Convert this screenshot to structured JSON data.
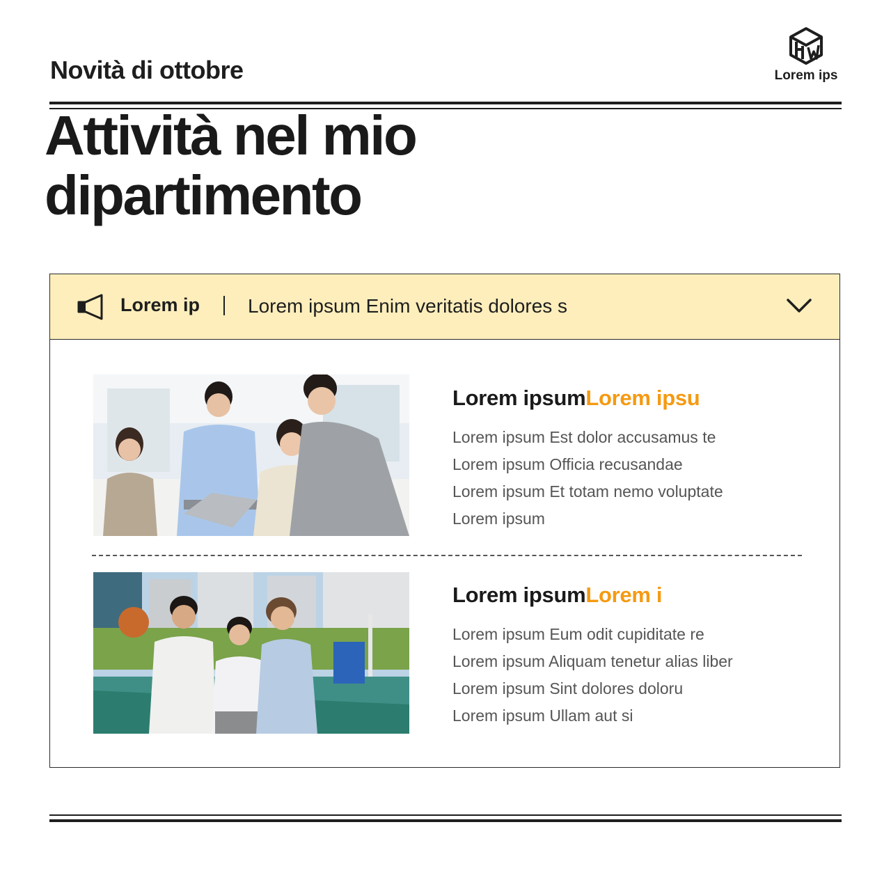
{
  "header": {
    "kicker": "Novità di ottobre",
    "logo_text": "Lorem ips",
    "logo_icon": "hw-cube-logo-icon"
  },
  "headline": {
    "line1": "Attività nel mio",
    "line2": "dipartimento"
  },
  "notice": {
    "icon": "megaphone-icon",
    "label": "Lorem ip",
    "text": "Lorem ipsum Enim veritatis dolores s",
    "toggle_icon": "chevron-down-icon",
    "background": "#fdeebb"
  },
  "items": [
    {
      "title_main": "Lorem ipsum",
      "title_highlight": "Lorem ipsu",
      "photo_subject": "office-team-photo",
      "lines": [
        "Lorem ipsum Est dolor accusamus te",
        "Lorem ipsum Officia recusandae",
        "Lorem ipsum Et totam nemo voluptate",
        "Lorem ipsum"
      ]
    },
    {
      "title_main": "Lorem ipsum",
      "title_highlight": "Lorem i",
      "photo_subject": "basketball-court-photo",
      "lines": [
        "Lorem ipsum Eum odit cupiditate re",
        "Lorem ipsum Aliquam tenetur alias liber",
        "Lorem ipsum Sint dolores doloru",
        "Lorem ipsum Ullam aut si"
      ]
    }
  ],
  "colors": {
    "accent": "#f59a12",
    "ink": "#1e1e1e",
    "body_text": "#555555"
  }
}
